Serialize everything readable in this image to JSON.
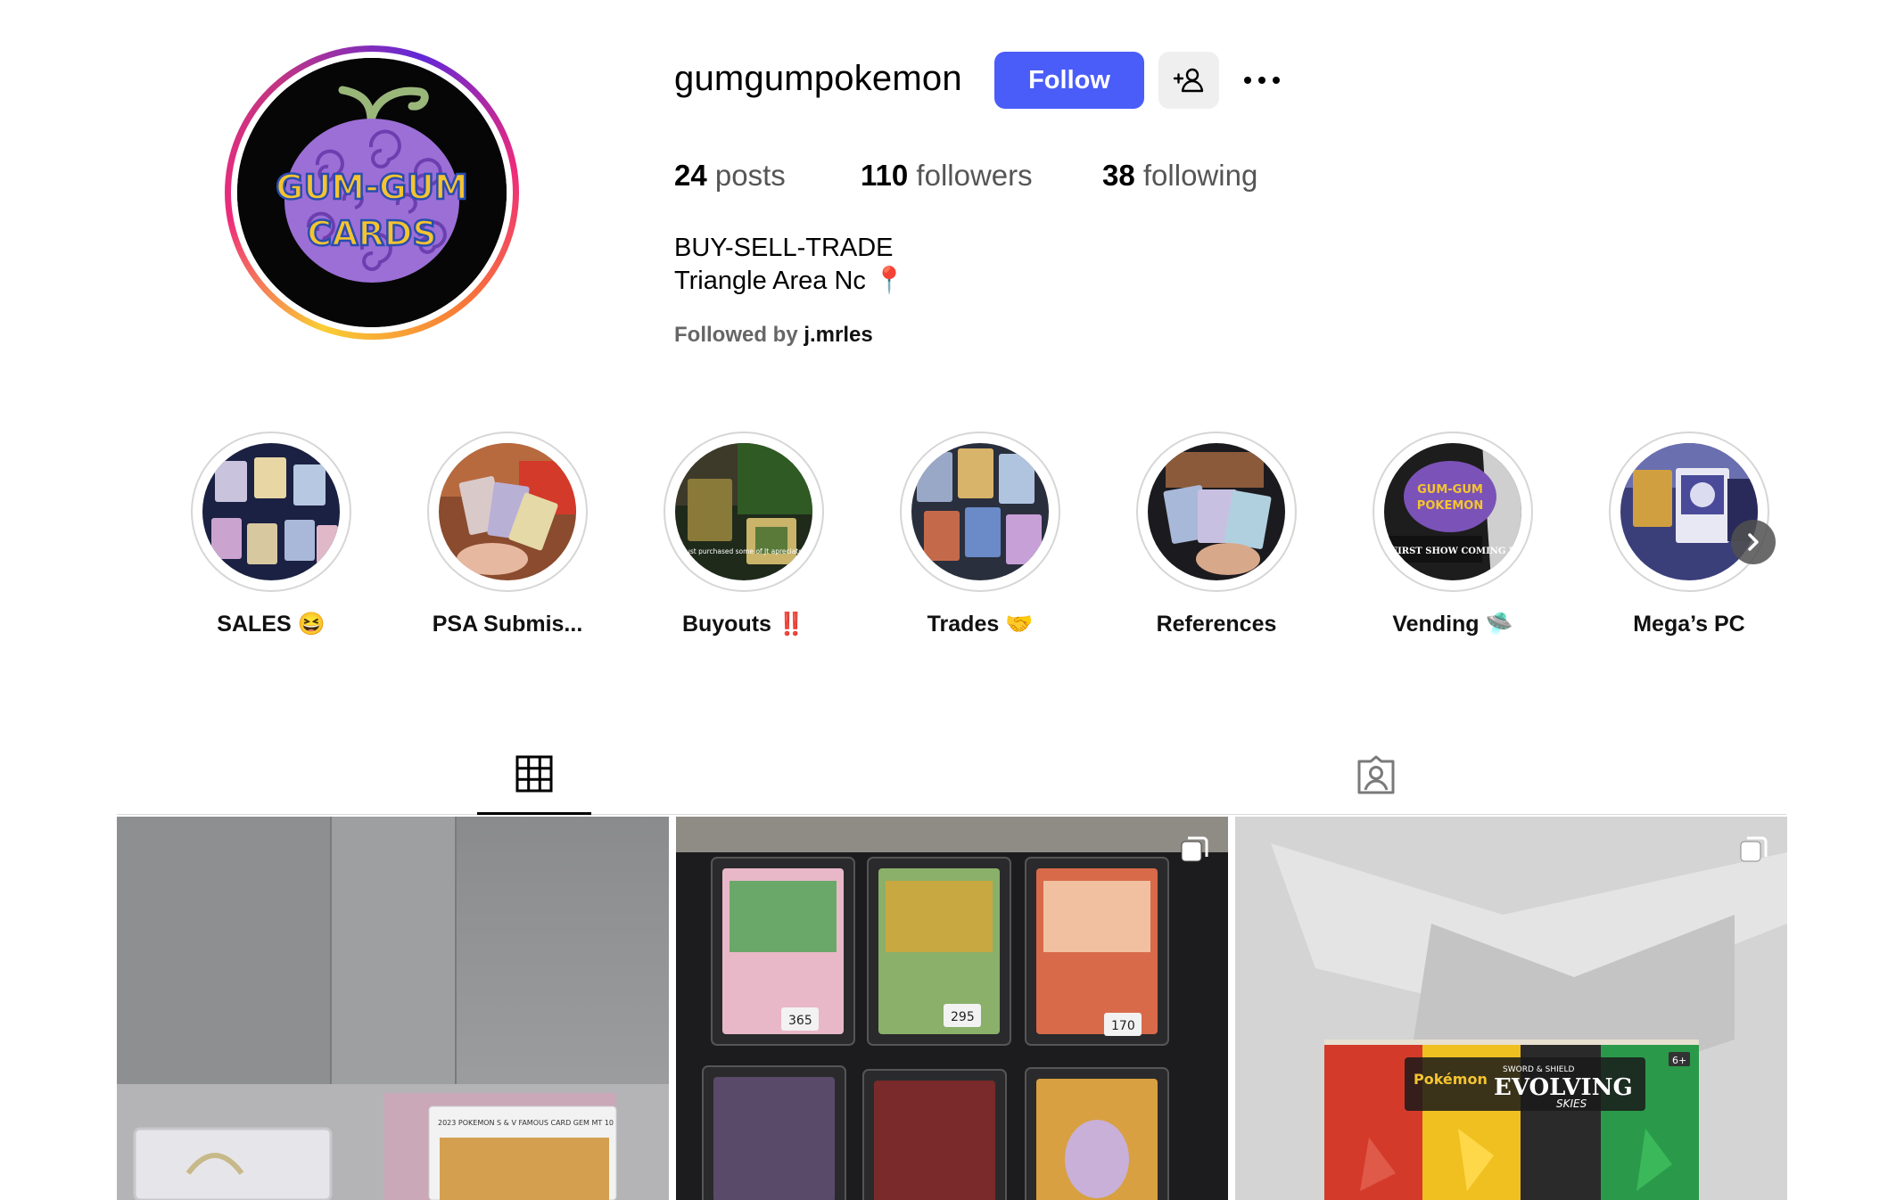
{
  "profile": {
    "username": "gumgumpokemon",
    "follow_label": "Follow",
    "avatar_text": [
      "GUM-GUM",
      "CARDS"
    ],
    "stats": {
      "posts_count": "24",
      "posts_label": "posts",
      "followers_count": "110",
      "followers_label": "followers",
      "following_count": "38",
      "following_label": "following"
    },
    "bio_lines": [
      "BUY-SELL-TRADE",
      "Triangle Area Nc 📍"
    ],
    "followed_by_prefix": "Followed by",
    "followed_by_user": "j.mrles"
  },
  "highlights": [
    {
      "label": "SALES 😆"
    },
    {
      "label": "PSA Submis..."
    },
    {
      "label": "Buyouts ‼️"
    },
    {
      "label": "Trades 🤝"
    },
    {
      "label": "References"
    },
    {
      "label": "Vending 🛸"
    },
    {
      "label": "Mega’s PC"
    }
  ],
  "highlight_overlays": {
    "buyouts": "just purchased some of Jt apreciate @muslehh",
    "vending_logo": [
      "GUM-GUM",
      "POKEMON"
    ],
    "vending_caption": "FIRST SHOW COMING UP 😁😁"
  },
  "tabs": [
    {
      "icon": "grid-icon",
      "active": true
    },
    {
      "icon": "tagged-icon",
      "active": false
    }
  ],
  "posts": [
    {
      "kind": "single",
      "psa_label": "2023 POKEMON S & V FAMOUS CARD GEM MT 10"
    },
    {
      "kind": "carousel",
      "prices": [
        "365",
        "295",
        "170"
      ]
    },
    {
      "kind": "carousel",
      "brand": "Pokémon",
      "set_top": "SWORD & SHIELD",
      "set_name": "EVOLVING",
      "set_sub": "SKIES",
      "age": "6+"
    }
  ],
  "colors": {
    "follow_button": "#4a5df9",
    "avatar_fruit": "#9b6fd6",
    "avatar_text": "#f4c430"
  }
}
